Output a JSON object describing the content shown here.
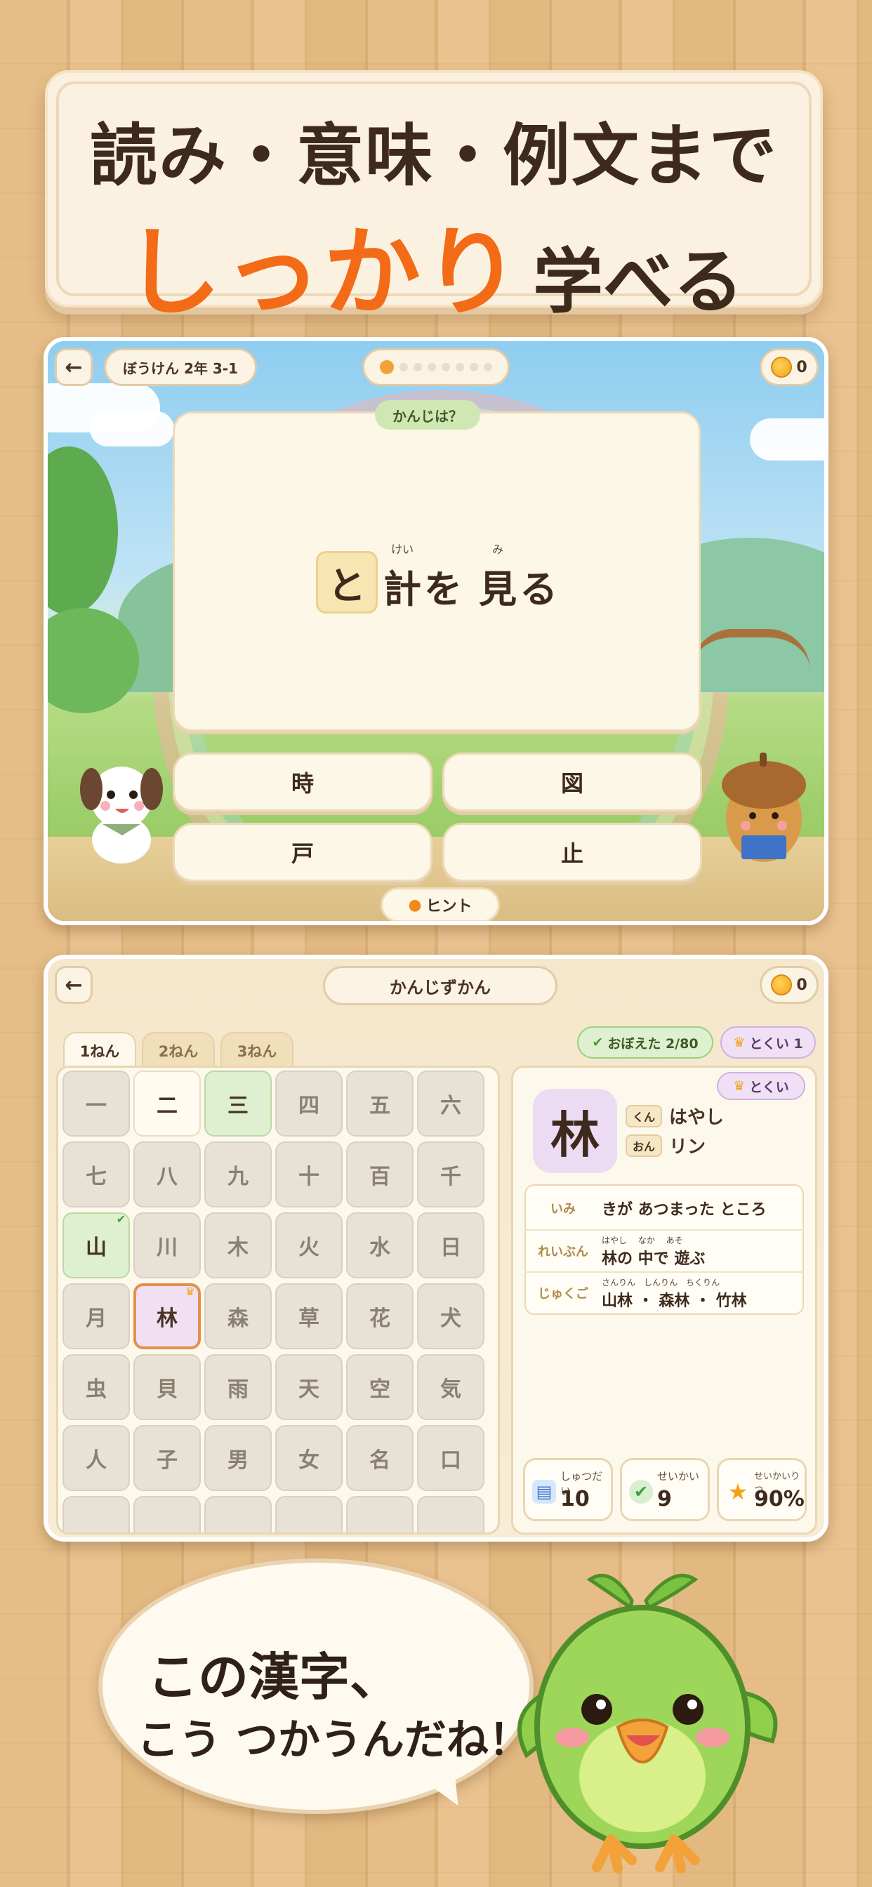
{
  "banner": {
    "line1": "読み・意味・例文まで",
    "line2_highlight": "しっかり",
    "line2_rest": "学べる",
    "highlight_color": "#f36b17"
  },
  "quiz": {
    "back_icon": "arrow-left-icon",
    "stage_label": "ぼうけん 2年 3-1",
    "progress": {
      "current": 1,
      "total": 8
    },
    "coins": "0",
    "prompt_tag": "かんじは？",
    "question": {
      "blank": "と",
      "word1": "計",
      "word1_ruby": "けい",
      "mid": "を",
      "word2": "見",
      "word2_ruby": "み",
      "tail": "る"
    },
    "answers": [
      "時",
      "図",
      "戸",
      "止"
    ],
    "hint_label": "ヒント"
  },
  "dict": {
    "title": "かんじずかん",
    "coins": "0",
    "tabs": [
      "1ねん",
      "2ねん",
      "3ねん"
    ],
    "learned_badge": "おぼえた 2/80",
    "tokui_badge": "とくい 1",
    "grid": [
      [
        "一",
        "二",
        "三",
        "四",
        "五",
        "六"
      ],
      [
        "七",
        "八",
        "九",
        "十",
        "百",
        "千"
      ],
      [
        "山",
        "川",
        "木",
        "火",
        "水",
        "日"
      ],
      [
        "月",
        "林",
        "森",
        "草",
        "花",
        "犬"
      ],
      [
        "虫",
        "貝",
        "雨",
        "天",
        "空",
        "気"
      ],
      [
        "人",
        "子",
        "男",
        "女",
        "名",
        "口"
      ]
    ],
    "detail": {
      "kanji": "林",
      "tokui_label": "とくい",
      "kun_label": "くん",
      "kun": "はやし",
      "on_label": "おん",
      "on": "リン",
      "imi_label": "いみ",
      "imi": "きが あつまった ところ",
      "reibun_label": "れいぶん",
      "reibun": "林の 中で 遊ぶ",
      "reibun_ruby": "はやし　 なか　 あそ",
      "jukugo_label": "じゅくご",
      "jukugo": "山林 ・ 森林 ・ 竹林",
      "jukugo_ruby": "さんりん　しんりん　ちくりん"
    },
    "stats": [
      {
        "label": "しゅつだい",
        "value": "10",
        "icon": "book-icon"
      },
      {
        "label": "せいかい",
        "value": "9",
        "icon": "check-icon"
      },
      {
        "label": "せいかいりつ",
        "value": "90%",
        "icon": "star-icon"
      }
    ]
  },
  "bubble": {
    "line1": "この漢字、",
    "line2": "こう つかうんだね！"
  }
}
